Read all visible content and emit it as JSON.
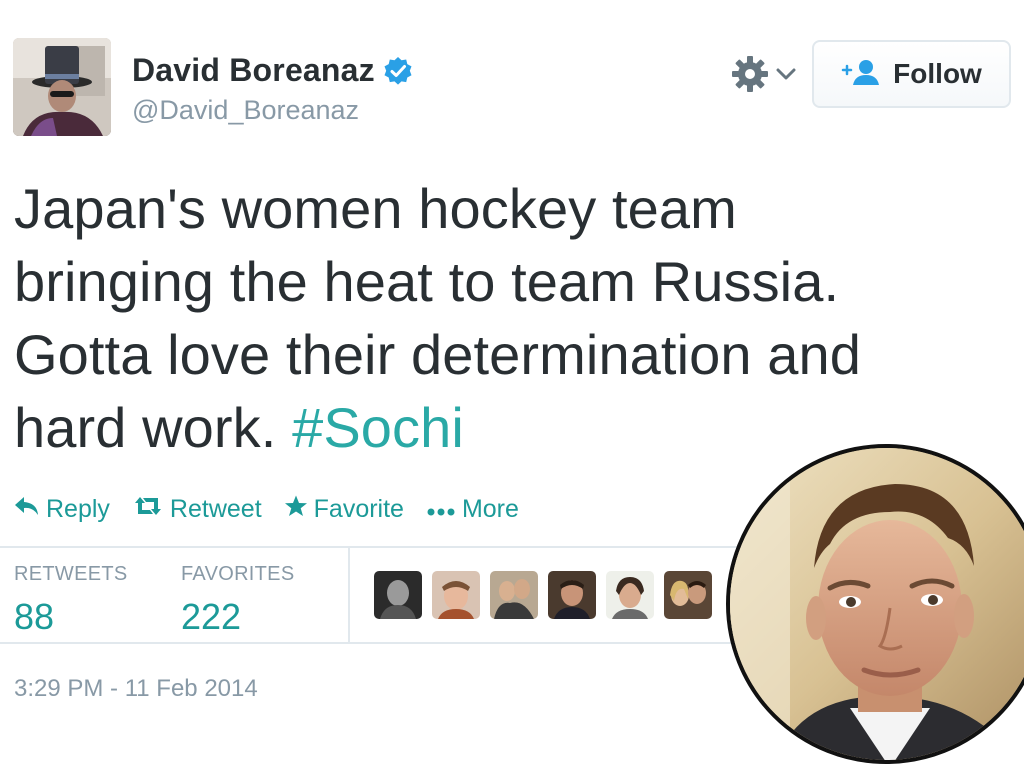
{
  "user": {
    "display_name": "David Boreanaz",
    "handle": "@David_Boreanaz"
  },
  "header": {
    "follow_label": "Follow"
  },
  "tweet": {
    "line1": "Japan's women hockey team",
    "line2": "bringing the heat to team Russia.",
    "line3": "Gotta love their determination and",
    "line4": "hard work. ",
    "hashtag": "#Sochi"
  },
  "actions": {
    "reply": "Reply",
    "retweet": "Retweet",
    "favorite": "Favorite",
    "more": "More"
  },
  "stats": {
    "retweets_label": "RETWEETS",
    "retweets_value": "88",
    "favorites_label": "FAVORITES",
    "favorites_value": "222"
  },
  "timestamp": "3:29 PM - 11 Feb 2014",
  "colors": {
    "accent": "#1c9a98",
    "hashtag": "#2aa9a6",
    "verified": "#2aa0e6",
    "muted": "#8899a6",
    "text": "#292f33"
  },
  "icons": {
    "verified": "verified-badge-icon",
    "gear": "gear-icon",
    "follow": "add-user-icon",
    "reply": "reply-icon",
    "retweet": "retweet-icon",
    "favorite": "star-icon",
    "more": "ellipsis-icon"
  }
}
